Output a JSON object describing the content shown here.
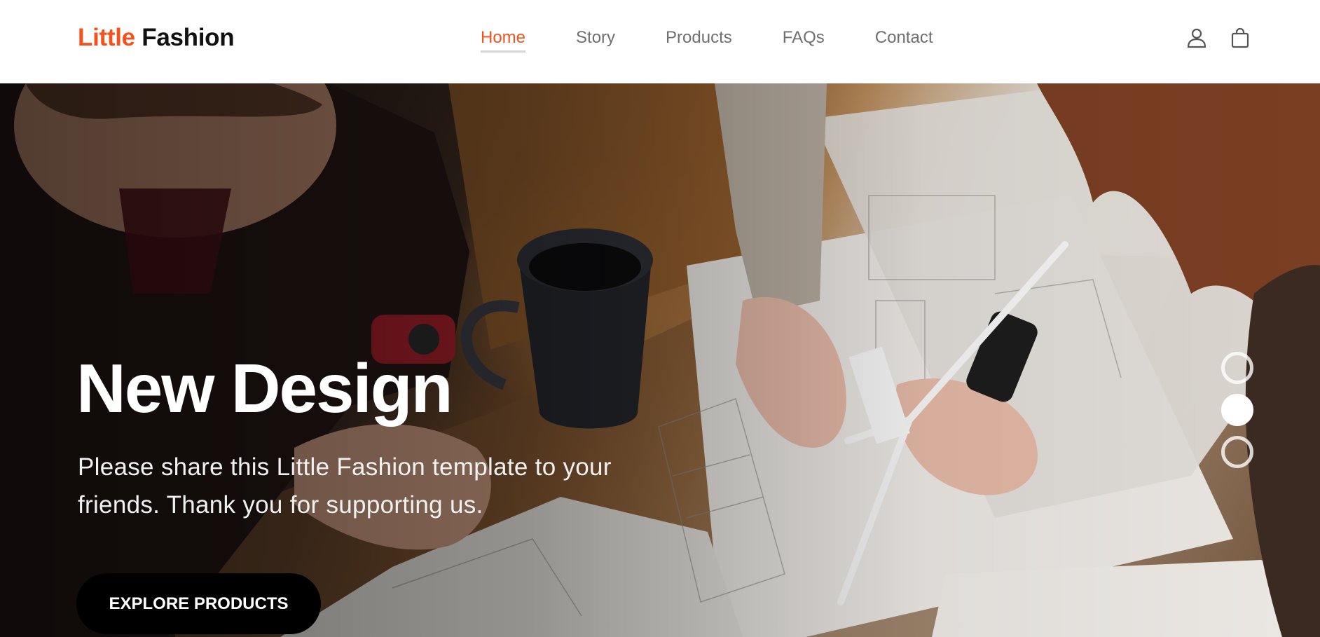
{
  "brand": {
    "accent": "Little",
    "name": "Fashion"
  },
  "nav": {
    "links": [
      {
        "label": "Home",
        "active": true
      },
      {
        "label": "Story",
        "active": false
      },
      {
        "label": "Products",
        "active": false
      },
      {
        "label": "FAQs",
        "active": false
      },
      {
        "label": "Contact",
        "active": false
      }
    ],
    "icons": [
      "user-icon",
      "shopping-bag-icon"
    ]
  },
  "hero": {
    "title": "New Design",
    "text": "Please share this Little Fashion template to your friends. Thank you for supporting us.",
    "button_label": "EXPLORE PRODUCTS",
    "slides": {
      "count": 3,
      "active_index": 1
    }
  },
  "colors": {
    "accent": "#f2521b",
    "nav_text": "#6f6f6f",
    "button_bg": "#000000",
    "hero_text": "#ffffff"
  }
}
